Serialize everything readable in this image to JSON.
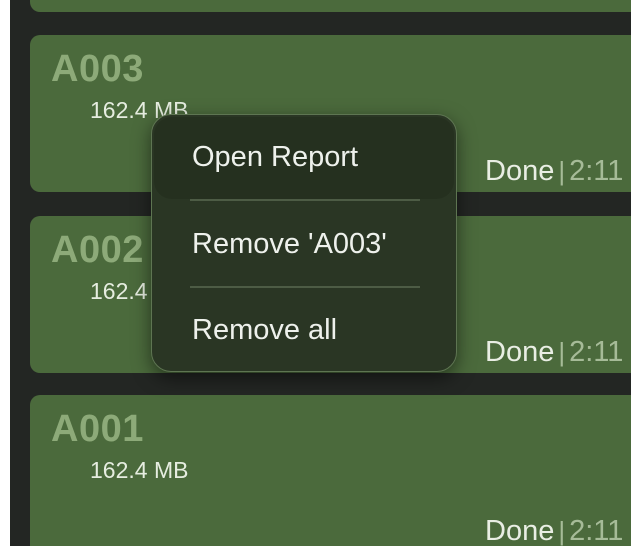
{
  "queue": {
    "items": [
      {
        "name": "A003",
        "size": "162.4 MB",
        "status": "Done",
        "separator": "|",
        "time": "2:11",
        "selected": true
      },
      {
        "name": "A002",
        "size": "162.4 MB",
        "status": "Done",
        "separator": "|",
        "time": "2:11",
        "selected": false
      },
      {
        "name": "A001",
        "size": "162.4 MB",
        "status": "Done",
        "separator": "|",
        "time": "2:11",
        "selected": false
      }
    ]
  },
  "context_menu": {
    "items": [
      {
        "label": "Open Report"
      },
      {
        "label": "Remove 'A003'"
      },
      {
        "label": "Remove all"
      }
    ]
  },
  "colors": {
    "card": "#4b6a3c",
    "background": "#232623",
    "menu": "#2a3624",
    "selection_outline": "#ffffff"
  }
}
